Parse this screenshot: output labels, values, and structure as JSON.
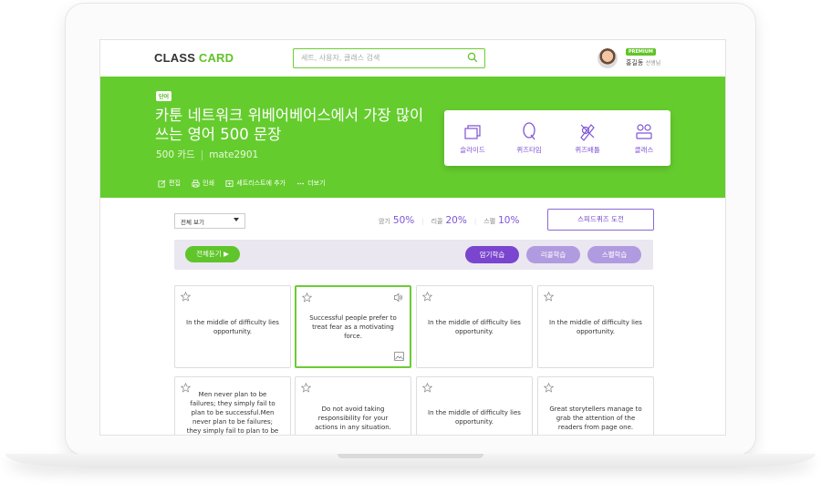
{
  "header": {
    "logo_part1": "CLASS ",
    "logo_part2": "CARD",
    "search_placeholder": "세트, 사용자, 클래스 검색",
    "profile_badge": "PREMIUM",
    "profile_name": "홍길동",
    "profile_role": "선생님"
  },
  "banner": {
    "tag": "단어",
    "title": "카툰 네트워크 위베어베어스에서 가장 많이 쓰는 영어 500 문장",
    "card_count": "500 카드",
    "author": "mate2901",
    "actions": [
      {
        "label": "편집",
        "icon": "edit-icon"
      },
      {
        "label": "인쇄",
        "icon": "print-icon"
      },
      {
        "label": "세트리스트에 추가",
        "icon": "add-list-icon"
      },
      {
        "label": "더보기",
        "icon": "more-icon"
      }
    ],
    "modes": [
      {
        "label": "슬라이드",
        "icon": "slide-icon"
      },
      {
        "label": "퀴즈타임",
        "icon": "quiz-icon"
      },
      {
        "label": "퀴즈배틀",
        "icon": "battle-icon"
      },
      {
        "label": "클래스",
        "icon": "class-icon"
      }
    ]
  },
  "controls": {
    "view_select": "전체 보기",
    "stats": [
      {
        "label": "암기",
        "value": "50%"
      },
      {
        "label": "리콜",
        "value": "20%"
      },
      {
        "label": "스펠",
        "value": "10%"
      }
    ],
    "speed_quiz": "스피드퀴즈 도전",
    "play_all": "전체듣기 ▶",
    "study_buttons": [
      {
        "label": "암기학습",
        "color": "#7a45cf"
      },
      {
        "label": "리콜학습",
        "color": "#b09be0"
      },
      {
        "label": "스펠학습",
        "color": "#b09be0"
      }
    ]
  },
  "cards": [
    {
      "text": "In the middle of difficulty lies opportunity."
    },
    {
      "text": "Successful people prefer to treat fear as a motivating force."
    },
    {
      "text": "In the middle of difficulty lies opportunity."
    },
    {
      "text": "In the middle of difficulty lies opportunity."
    },
    {
      "text": "Men never plan to be failures; they simply fail to plan to be successful.Men never plan to be failures; they simply fail to plan to be successful."
    },
    {
      "text": "Do not avoid taking responsibility for your actions in any situation."
    },
    {
      "text": "In the middle of difficulty lies opportunity."
    },
    {
      "text": "Great storytellers manage to grab the attention of the readers from page one."
    }
  ],
  "colors": {
    "green": "#65cc2e",
    "purple": "#8054d6"
  }
}
